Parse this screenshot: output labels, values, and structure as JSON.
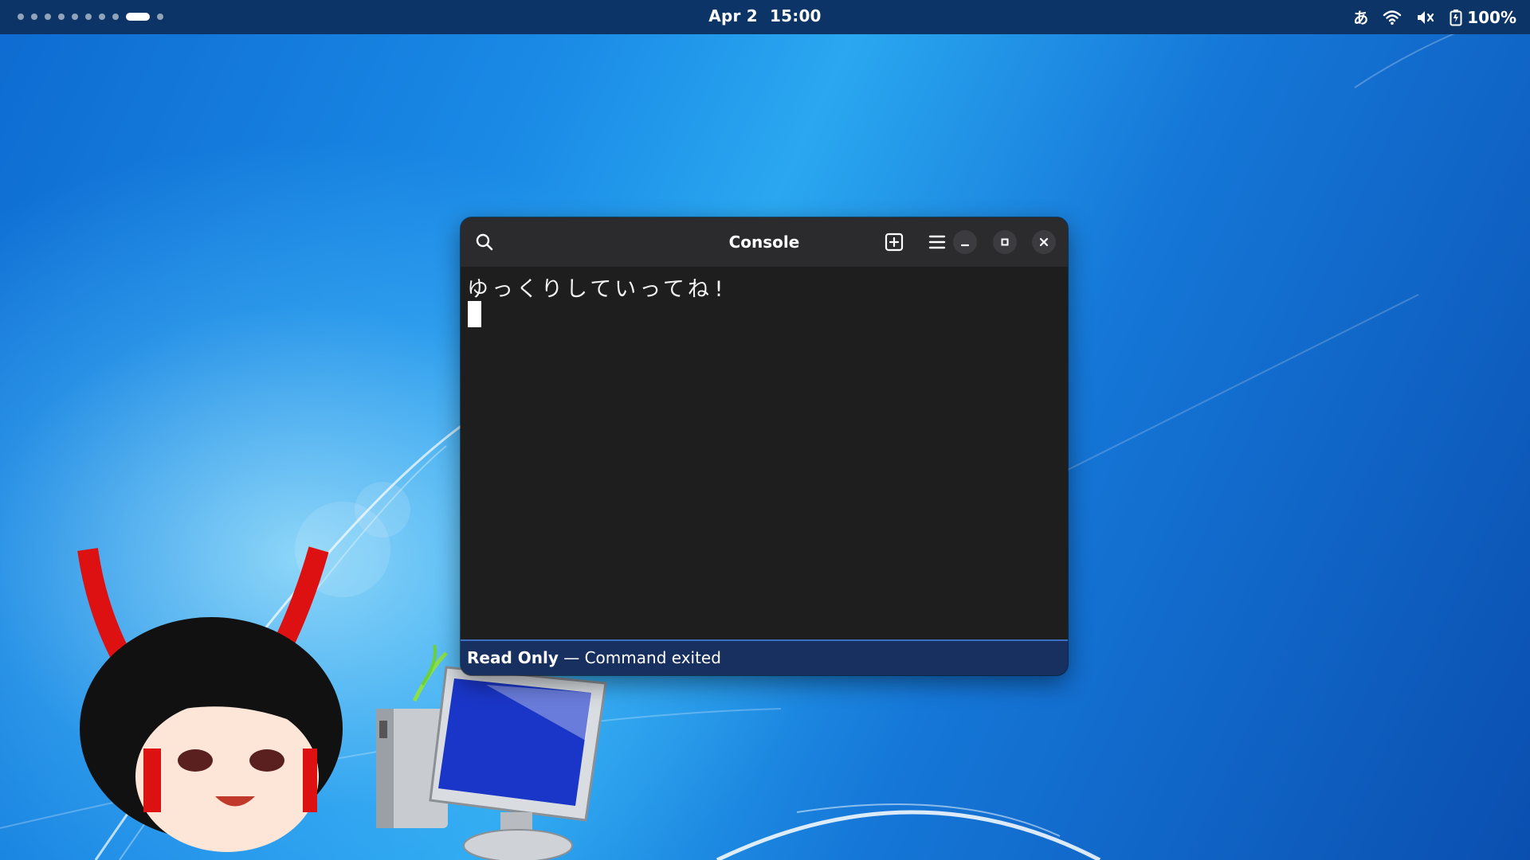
{
  "topbar": {
    "clock_date": "Apr 2",
    "clock_time": "15:00",
    "input_method": "あ",
    "battery_percent": "100%",
    "workspaces_count": 10,
    "active_workspace": 9
  },
  "window": {
    "title": "Console",
    "terminal_output": "ゆっくりしていってね!",
    "status_title": "Read Only",
    "status_separator": " — ",
    "status_message": "Command exited"
  },
  "icons": {
    "search": "search-icon",
    "new_tab": "new-tab-icon",
    "menu": "hamburger-menu-icon",
    "minimize": "minimize-icon",
    "maximize": "maximize-icon",
    "close": "close-icon",
    "wifi": "wifi-icon",
    "volume": "volume-muted-icon",
    "battery": "battery-icon"
  },
  "colors": {
    "topbar_bg": "#0d3466",
    "headerbar_bg": "#2b2b2d",
    "terminal_bg": "#1e1e1e",
    "statusbar_bg": "#17305f",
    "statusbar_accent": "#3f6fbf"
  }
}
